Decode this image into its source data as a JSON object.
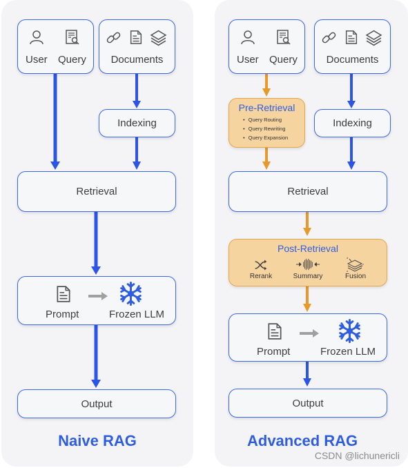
{
  "colors": {
    "blue": "#2e5de0",
    "box_border": "#3b67e3",
    "orange_arrow": "#e69a2b",
    "orange_fill": "#f6d4a0",
    "panel_bg": "#f4f4f6",
    "icon_gray": "#555555",
    "snowflake": "#2e5de0"
  },
  "naive": {
    "title": "Naive RAG",
    "input": {
      "user": "User",
      "query": "Query"
    },
    "documents": "Documents",
    "indexing": "Indexing",
    "retrieval": "Retrieval",
    "prompt": "Prompt",
    "frozen_llm": "Frozen LLM",
    "output": "Output"
  },
  "advanced": {
    "title": "Advanced RAG",
    "input": {
      "user": "User",
      "query": "Query"
    },
    "documents": "Documents",
    "indexing": "Indexing",
    "pre_retrieval": {
      "title": "Pre-Retrieval",
      "items": [
        "Query Routing",
        "Query Rewriting",
        "Query Expansion"
      ]
    },
    "retrieval": "Retrieval",
    "post_retrieval": {
      "title": "Post-Retrieval",
      "items": [
        {
          "label": "Rerank",
          "icon": "shuffle-icon"
        },
        {
          "label": "Summary",
          "icon": "compress-icon"
        },
        {
          "label": "Fusion",
          "icon": "layers-fusion-icon"
        }
      ]
    },
    "prompt": "Prompt",
    "frozen_llm": "Frozen LLM",
    "output": "Output"
  },
  "watermark": "CSDN @lichunericli"
}
